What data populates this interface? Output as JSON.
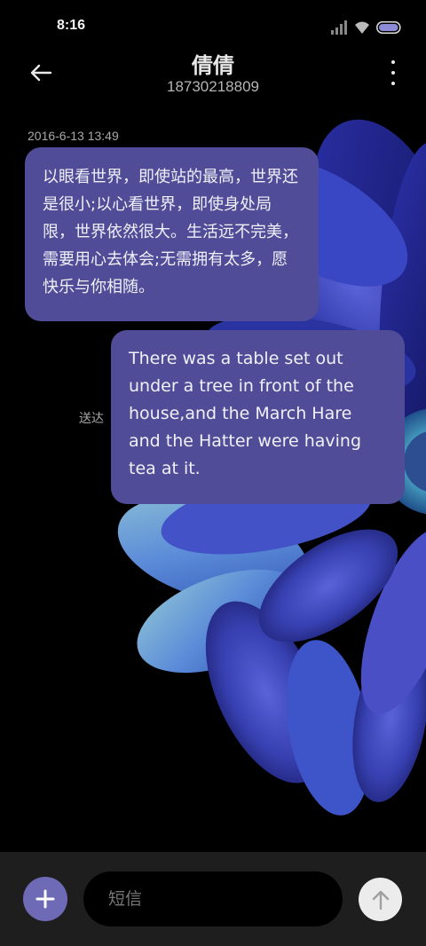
{
  "status_bar": {
    "time": "8:16",
    "icons": [
      "signal-icon",
      "wifi-icon",
      "battery-icon"
    ]
  },
  "header": {
    "contact_name": "倩倩",
    "contact_number": "18730218809",
    "back_icon": "arrow-left-icon",
    "more_icon": "more-vertical-icon"
  },
  "conversation": {
    "timestamp": "2016-6-13 13:49",
    "messages": [
      {
        "direction": "incoming",
        "text": "以眼看世界，即使站的最高，世界还是很小;以心看世界，即使身处局限，世界依然很大。生活远不完美，需要用心去体会;无需拥有太多，愿快乐与你相随。"
      },
      {
        "direction": "outgoing",
        "text": "There was a table set out under a tree in front of the house,and the March Hare and the Hatter were having tea at it.",
        "status": "送达"
      }
    ]
  },
  "composer": {
    "placeholder": "短信",
    "value": "",
    "add_icon": "plus-icon",
    "send_icon": "arrow-up-icon"
  },
  "colors": {
    "background": "#000000",
    "bubble": "#514c97",
    "accent": "#6f6ab6",
    "composer_bar": "#1e1e1e"
  }
}
